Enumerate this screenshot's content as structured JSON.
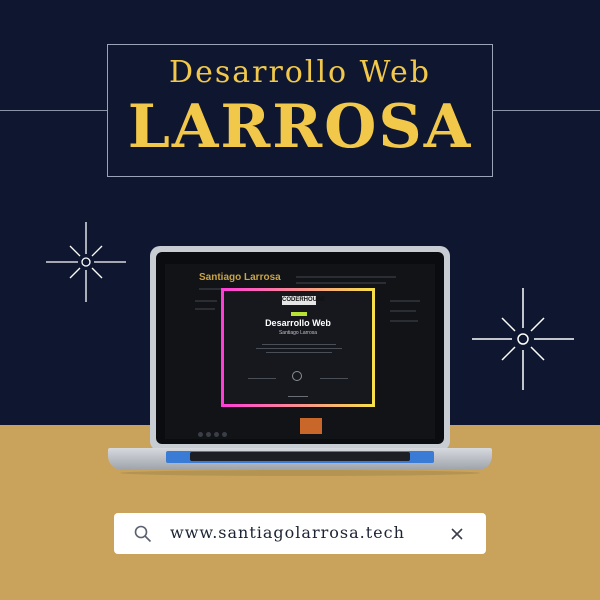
{
  "header": {
    "subtitle": "Desarrollo Web",
    "title": "LARROSA"
  },
  "laptop_screen": {
    "site_heading": "Santiago Larrosa",
    "certificate": {
      "logo_text": "CODERHOUSE",
      "course": "Desarrollo Web",
      "student": "Santiago Larrosa"
    }
  },
  "search": {
    "value": "www.santiagolarrosa.tech",
    "search_icon": "search-icon",
    "close_icon": "close-icon"
  },
  "colors": {
    "navy": "#0f1730",
    "gold_text": "#f2c84a",
    "sand": "#c9a35b",
    "neon_pink": "#ff3ed8",
    "neon_yellow": "#f7e04a"
  }
}
